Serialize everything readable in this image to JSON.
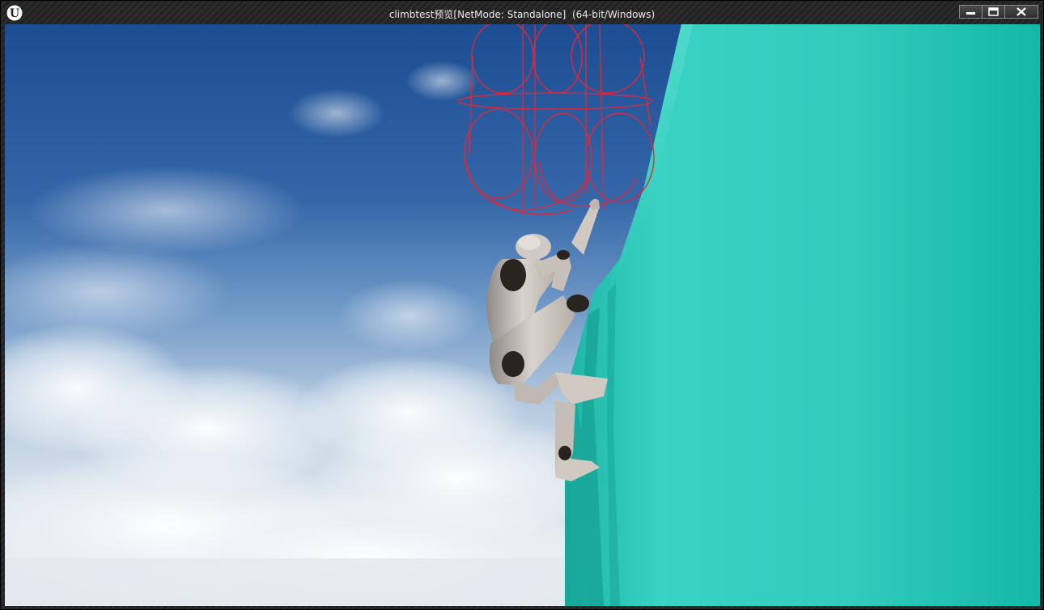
{
  "window": {
    "title": "climbtest预览[NetMode: Standalone]  (64-bit/Windows)",
    "logo_letter": "U"
  },
  "titlebar_buttons": [
    {
      "name": "minimize-button",
      "icon": "minimize-icon"
    },
    {
      "name": "maximize-button",
      "icon": "maximize-icon"
    },
    {
      "name": "close-button",
      "icon": "close-icon"
    }
  ],
  "colors": {
    "wall": "#2fcdbb",
    "wall_shadow": "#18a89a",
    "debug_capsules": "#e0283a",
    "sky_top": "#1c4d92",
    "sky_bottom": "#e7ecef"
  }
}
